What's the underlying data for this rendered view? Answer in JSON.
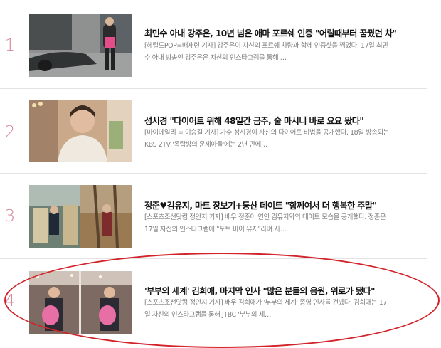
{
  "articles": [
    {
      "rank": "1",
      "title": "최민수 아내 강주은, 10년 넘은 애마 포르쉐 인증 \"어릴때부터 꿈꿨던 차\"",
      "desc_line1": "[헤럴드POP=배재련 기자] 강주은이 자신의 포르쉐 차량과 함께 인증샷을 찍었다. 17일 최민",
      "desc_line2": "수 아내 방송인 강주은은 자신의 인스타그램을 통해 …"
    },
    {
      "rank": "2",
      "title": "성시경 \"다이어트 위해 48일간 금주, 술 마시니 바로 요요 왔다\"",
      "desc_line1": "[마이데일리 = 이승길 기자] 가수 성시경이 자신의 다이어트 비법을 공개했다. 18일 방송되는",
      "desc_line2": "KBS 2TV '옥탑방의 문제아들'에는 2년 만에…"
    },
    {
      "rank": "3",
      "title": "정준♥김유지, 마트 장보기+등산 데이트 \"함께여서 더 행복한 주말\"",
      "desc_line1": "[스포츠조선닷컴 정안지 기자] 배우 정준이 연인 김유지와의 데이트 모습을 공개했다. 정준은",
      "desc_line2": "17일 자신의 인스타그램에 \"포토 바이 유지\"라며 사…"
    },
    {
      "rank": "4",
      "title": "'부부의 세계' 김희애, 마지막 인사 \"많은 분들의 응원, 위로가 됐다\"",
      "desc_line1": "[스포츠조선닷컴 정안지 기자] 배우 김희애가 '부부의 세계' 종영 인사를 건넸다. 김희애는 17",
      "desc_line2": "일 자신의 인스타그램을 통해 JTBC '부부의 세…"
    }
  ],
  "colors": {
    "rank": "#d9879a",
    "highlight_circle": "#d2232a"
  }
}
